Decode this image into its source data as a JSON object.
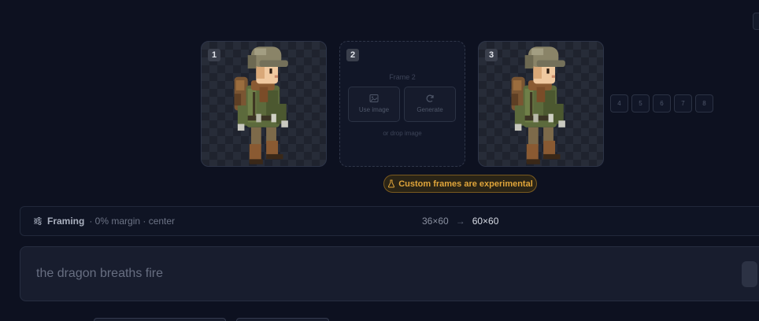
{
  "frames": [
    {
      "number": "1",
      "state": "filled"
    },
    {
      "number": "2",
      "state": "empty",
      "title": "Frame 2",
      "use_image_label": "Use image",
      "generate_label": "Generate",
      "drop_hint": "or drop image"
    },
    {
      "number": "3",
      "state": "filled"
    }
  ],
  "extra_slots": [
    "4",
    "5",
    "6",
    "7",
    "8"
  ],
  "experimental_badge": "Custom frames are experimental",
  "framing": {
    "label": "Framing",
    "detail": "· 0% margin · center",
    "from_size": "36×60",
    "arrow": "→",
    "to_size": "60×60"
  },
  "prompt": {
    "value": "the dragon breaths fire"
  },
  "colors": {
    "background": "#0d1120",
    "accent_amber": "#e0a53a",
    "panel": "#181d2e"
  }
}
